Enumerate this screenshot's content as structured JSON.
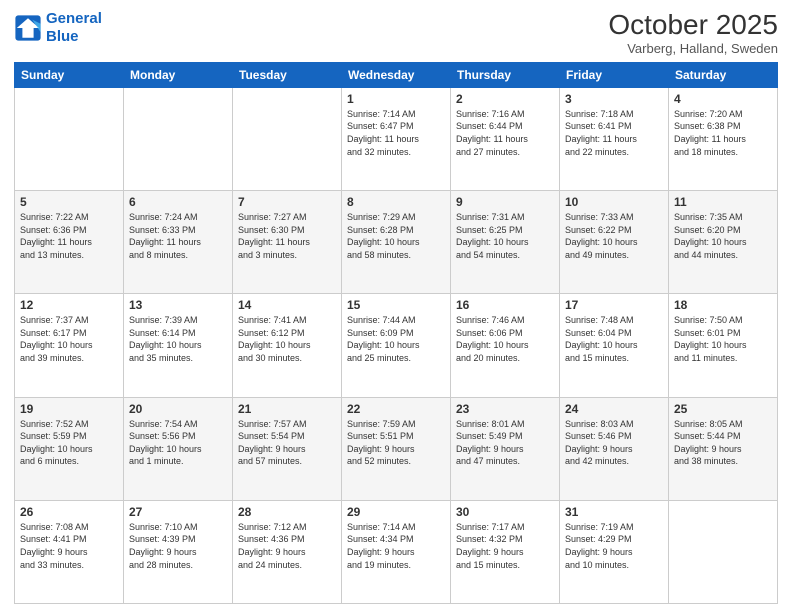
{
  "logo": {
    "line1": "General",
    "line2": "Blue"
  },
  "title": "October 2025",
  "subtitle": "Varberg, Halland, Sweden",
  "days_of_week": [
    "Sunday",
    "Monday",
    "Tuesday",
    "Wednesday",
    "Thursday",
    "Friday",
    "Saturday"
  ],
  "weeks": [
    [
      {
        "day": "",
        "info": ""
      },
      {
        "day": "",
        "info": ""
      },
      {
        "day": "",
        "info": ""
      },
      {
        "day": "1",
        "info": "Sunrise: 7:14 AM\nSunset: 6:47 PM\nDaylight: 11 hours\nand 32 minutes."
      },
      {
        "day": "2",
        "info": "Sunrise: 7:16 AM\nSunset: 6:44 PM\nDaylight: 11 hours\nand 27 minutes."
      },
      {
        "day": "3",
        "info": "Sunrise: 7:18 AM\nSunset: 6:41 PM\nDaylight: 11 hours\nand 22 minutes."
      },
      {
        "day": "4",
        "info": "Sunrise: 7:20 AM\nSunset: 6:38 PM\nDaylight: 11 hours\nand 18 minutes."
      }
    ],
    [
      {
        "day": "5",
        "info": "Sunrise: 7:22 AM\nSunset: 6:36 PM\nDaylight: 11 hours\nand 13 minutes."
      },
      {
        "day": "6",
        "info": "Sunrise: 7:24 AM\nSunset: 6:33 PM\nDaylight: 11 hours\nand 8 minutes."
      },
      {
        "day": "7",
        "info": "Sunrise: 7:27 AM\nSunset: 6:30 PM\nDaylight: 11 hours\nand 3 minutes."
      },
      {
        "day": "8",
        "info": "Sunrise: 7:29 AM\nSunset: 6:28 PM\nDaylight: 10 hours\nand 58 minutes."
      },
      {
        "day": "9",
        "info": "Sunrise: 7:31 AM\nSunset: 6:25 PM\nDaylight: 10 hours\nand 54 minutes."
      },
      {
        "day": "10",
        "info": "Sunrise: 7:33 AM\nSunset: 6:22 PM\nDaylight: 10 hours\nand 49 minutes."
      },
      {
        "day": "11",
        "info": "Sunrise: 7:35 AM\nSunset: 6:20 PM\nDaylight: 10 hours\nand 44 minutes."
      }
    ],
    [
      {
        "day": "12",
        "info": "Sunrise: 7:37 AM\nSunset: 6:17 PM\nDaylight: 10 hours\nand 39 minutes."
      },
      {
        "day": "13",
        "info": "Sunrise: 7:39 AM\nSunset: 6:14 PM\nDaylight: 10 hours\nand 35 minutes."
      },
      {
        "day": "14",
        "info": "Sunrise: 7:41 AM\nSunset: 6:12 PM\nDaylight: 10 hours\nand 30 minutes."
      },
      {
        "day": "15",
        "info": "Sunrise: 7:44 AM\nSunset: 6:09 PM\nDaylight: 10 hours\nand 25 minutes."
      },
      {
        "day": "16",
        "info": "Sunrise: 7:46 AM\nSunset: 6:06 PM\nDaylight: 10 hours\nand 20 minutes."
      },
      {
        "day": "17",
        "info": "Sunrise: 7:48 AM\nSunset: 6:04 PM\nDaylight: 10 hours\nand 15 minutes."
      },
      {
        "day": "18",
        "info": "Sunrise: 7:50 AM\nSunset: 6:01 PM\nDaylight: 10 hours\nand 11 minutes."
      }
    ],
    [
      {
        "day": "19",
        "info": "Sunrise: 7:52 AM\nSunset: 5:59 PM\nDaylight: 10 hours\nand 6 minutes."
      },
      {
        "day": "20",
        "info": "Sunrise: 7:54 AM\nSunset: 5:56 PM\nDaylight: 10 hours\nand 1 minute."
      },
      {
        "day": "21",
        "info": "Sunrise: 7:57 AM\nSunset: 5:54 PM\nDaylight: 9 hours\nand 57 minutes."
      },
      {
        "day": "22",
        "info": "Sunrise: 7:59 AM\nSunset: 5:51 PM\nDaylight: 9 hours\nand 52 minutes."
      },
      {
        "day": "23",
        "info": "Sunrise: 8:01 AM\nSunset: 5:49 PM\nDaylight: 9 hours\nand 47 minutes."
      },
      {
        "day": "24",
        "info": "Sunrise: 8:03 AM\nSunset: 5:46 PM\nDaylight: 9 hours\nand 42 minutes."
      },
      {
        "day": "25",
        "info": "Sunrise: 8:05 AM\nSunset: 5:44 PM\nDaylight: 9 hours\nand 38 minutes."
      }
    ],
    [
      {
        "day": "26",
        "info": "Sunrise: 7:08 AM\nSunset: 4:41 PM\nDaylight: 9 hours\nand 33 minutes."
      },
      {
        "day": "27",
        "info": "Sunrise: 7:10 AM\nSunset: 4:39 PM\nDaylight: 9 hours\nand 28 minutes."
      },
      {
        "day": "28",
        "info": "Sunrise: 7:12 AM\nSunset: 4:36 PM\nDaylight: 9 hours\nand 24 minutes."
      },
      {
        "day": "29",
        "info": "Sunrise: 7:14 AM\nSunset: 4:34 PM\nDaylight: 9 hours\nand 19 minutes."
      },
      {
        "day": "30",
        "info": "Sunrise: 7:17 AM\nSunset: 4:32 PM\nDaylight: 9 hours\nand 15 minutes."
      },
      {
        "day": "31",
        "info": "Sunrise: 7:19 AM\nSunset: 4:29 PM\nDaylight: 9 hours\nand 10 minutes."
      },
      {
        "day": "",
        "info": ""
      }
    ]
  ]
}
